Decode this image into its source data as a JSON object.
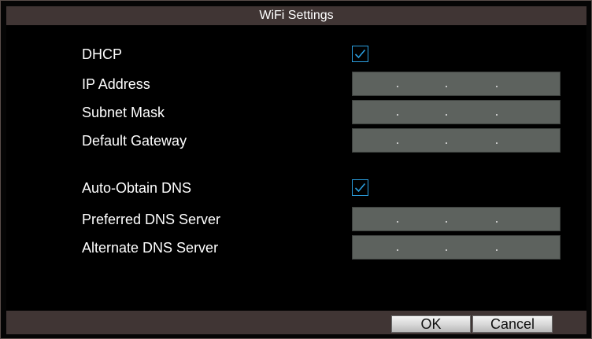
{
  "window": {
    "title": "WiFi Settings"
  },
  "form": {
    "dhcp": {
      "label": "DHCP",
      "checked": true
    },
    "ip_address": {
      "label": "IP Address",
      "value": ". . ."
    },
    "subnet_mask": {
      "label": "Subnet Mask",
      "value": ". . ."
    },
    "default_gateway": {
      "label": "Default Gateway",
      "value": ". . ."
    },
    "auto_dns": {
      "label": "Auto-Obtain DNS",
      "checked": true
    },
    "preferred_dns": {
      "label": "Preferred DNS Server",
      "value": ". . ."
    },
    "alternate_dns": {
      "label": "Alternate DNS Server",
      "value": ". . ."
    }
  },
  "buttons": {
    "ok_label": "OK",
    "cancel_label": "Cancel"
  },
  "colors": {
    "title_bar_bg": "#403534",
    "checkbox_accent": "#2b9fe0",
    "field_bg": "#5d625e"
  },
  "icons": {
    "checkmark": "check-icon"
  }
}
